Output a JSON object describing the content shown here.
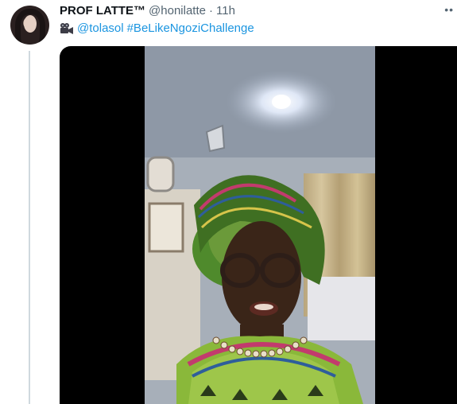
{
  "tweet": {
    "display_name": "PROF LATTE™",
    "handle": "@honilatte",
    "separator": "·",
    "time": "11h",
    "more_label": "••",
    "icon": "movie-camera-icon",
    "mention": "@tolasol",
    "hashtag": "#BeLikeNgoziChallenge"
  },
  "colors": {
    "link": "#1b95e0",
    "secondary_text": "#536471",
    "thread_line": "#cfd9de"
  }
}
